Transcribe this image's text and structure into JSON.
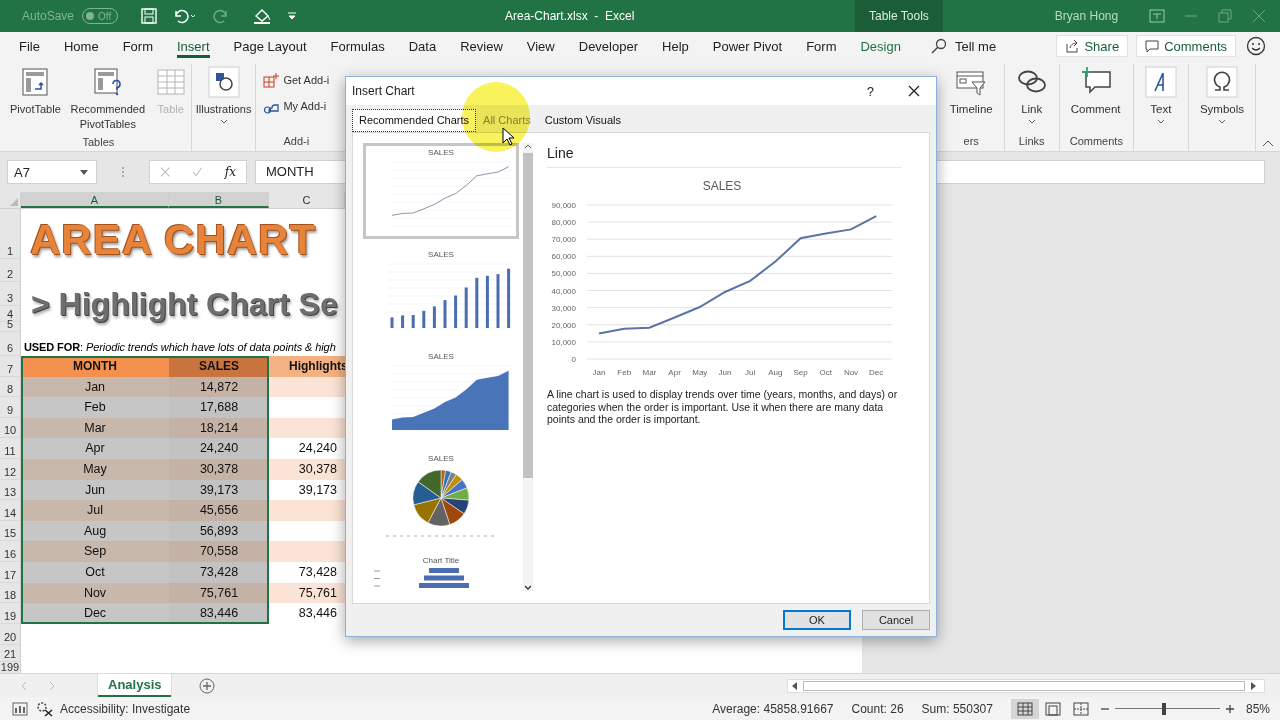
{
  "title_bar": {
    "autosave_label": "AutoSave",
    "autosave_toggle": {
      "label": "Off",
      "on": false
    },
    "document_title": "Area-Chart.xlsx  -  Excel",
    "context_tab": "Table Tools",
    "user_name": "Bryan Hong"
  },
  "ribbon_tabs": [
    {
      "label": "File",
      "selected": false,
      "kind": "plain"
    },
    {
      "label": "Home",
      "selected": false,
      "kind": "plain"
    },
    {
      "label": "Form",
      "selected": false,
      "kind": "plain"
    },
    {
      "label": "Insert",
      "selected": true,
      "kind": "plain"
    },
    {
      "label": "Page Layout",
      "selected": false,
      "kind": "plain"
    },
    {
      "label": "Formulas",
      "selected": false,
      "kind": "plain"
    },
    {
      "label": "Data",
      "selected": false,
      "kind": "plain"
    },
    {
      "label": "Review",
      "selected": false,
      "kind": "plain"
    },
    {
      "label": "View",
      "selected": false,
      "kind": "plain"
    },
    {
      "label": "Developer",
      "selected": false,
      "kind": "plain"
    },
    {
      "label": "Help",
      "selected": false,
      "kind": "plain"
    },
    {
      "label": "Power Pivot",
      "selected": false,
      "kind": "plain"
    },
    {
      "label": "Form",
      "selected": false,
      "kind": "plain"
    },
    {
      "label": "Design",
      "selected": false,
      "kind": "contextual"
    }
  ],
  "tell_me": "Tell me",
  "share_button": "Share",
  "comments_button": "Comments",
  "ribbon_left": [
    {
      "label": "Tables",
      "commands": [
        {
          "label": "PivotTable",
          "kind": "pivot",
          "disabled": false,
          "dropdown": false
        },
        {
          "label": "Recommended PivotTables",
          "kind": "recpivot",
          "disabled": false,
          "dropdown": false
        },
        {
          "label": "Table",
          "kind": "table",
          "disabled": true,
          "dropdown": false
        }
      ]
    },
    {
      "commands": [
        {
          "label": "Illustrations",
          "kind": "illus",
          "disabled": false,
          "dropdown": true
        }
      ]
    },
    {
      "label": "Add-i",
      "commands": [
        {
          "label": "Get Add-i",
          "kind": "getadd",
          "disabled": false,
          "dropdown": false
        },
        {
          "label": "My Add-i",
          "kind": "myadd",
          "disabled": false,
          "dropdown": false
        }
      ]
    }
  ],
  "ribbon_right": [
    {
      "label": "ers",
      "commands": [
        {
          "label": "Timeline",
          "kind": "timeline",
          "disabled": false,
          "dropdown": false
        }
      ]
    },
    {
      "label": "Links",
      "commands": [
        {
          "label": "Link",
          "kind": "link",
          "disabled": false,
          "dropdown": true
        }
      ]
    },
    {
      "label": "Comments",
      "commands": [
        {
          "label": "Comment",
          "kind": "comment",
          "disabled": false,
          "dropdown": false
        }
      ]
    },
    {
      "commands": [
        {
          "label": "Text",
          "kind": "text",
          "disabled": false,
          "dropdown": true
        }
      ]
    },
    {
      "commands": [
        {
          "label": "Symbols",
          "kind": "symbols",
          "disabled": false,
          "dropdown": true
        }
      ]
    }
  ],
  "formula_bar": {
    "name_box": "A7",
    "insert_function": "fx",
    "formula": "MONTH"
  },
  "sheet": {
    "column_headers": [
      "A",
      "B",
      "C"
    ],
    "top_row_numbers": [
      "1",
      "2",
      "3",
      "4",
      "5",
      "6"
    ],
    "title": "AREA CHART",
    "subtitle": "> Highlight Chart Se",
    "note": "**USED FOR**: *Periodic trends which have lots of data points & high*",
    "table": {
      "selected": true,
      "header_row_number": "7",
      "columns": [
        "MONTH",
        "SALES",
        "Highlights"
      ],
      "rows": [
        {
          "number": "8",
          "month": "Jan",
          "sales": "14,872"
        },
        {
          "number": "9",
          "month": "Feb",
          "sales": "17,688"
        },
        {
          "number": "10",
          "month": "Mar",
          "sales": "18,214"
        },
        {
          "number": "11",
          "month": "Apr",
          "sales": "24,240",
          "highlight": "24,240"
        },
        {
          "number": "12",
          "month": "May",
          "sales": "30,378",
          "highlight": "30,378"
        },
        {
          "number": "13",
          "month": "Jun",
          "sales": "39,173",
          "highlight": "39,173"
        },
        {
          "number": "14",
          "month": "Jul",
          "sales": "45,656"
        },
        {
          "number": "15",
          "month": "Aug",
          "sales": "56,893"
        },
        {
          "number": "16",
          "month": "Sep",
          "sales": "70,558"
        },
        {
          "number": "17",
          "month": "Oct",
          "sales": "73,428",
          "highlight": "73,428"
        },
        {
          "number": "18",
          "month": "Nov",
          "sales": "75,761",
          "highlight": "75,761"
        },
        {
          "number": "19",
          "month": "Dec",
          "sales": "83,446",
          "highlight": "83,446"
        }
      ]
    },
    "bottom_row_numbers": [
      "20",
      "21",
      "199"
    ]
  },
  "sheet_tabs": [
    {
      "label": "Analysis",
      "selected": true
    }
  ],
  "status_bar": {
    "accessibility": "Accessibility: Investigate",
    "average": "Average: 45858.91667",
    "count": "Count: 26",
    "sum": "Sum: 550307",
    "views": [
      {
        "kind": "normal",
        "selected": true
      },
      {
        "kind": "page-layout",
        "selected": false
      },
      {
        "kind": "page-break",
        "selected": false
      }
    ],
    "zoom": {
      "level": 0.47,
      "reading": "85%"
    }
  },
  "dialog": {
    "title": "Insert Chart",
    "help": "?",
    "tabs": [
      {
        "label": "Recommended Charts",
        "selected": true
      },
      {
        "label": "All Charts",
        "selected": false
      },
      {
        "label": "Custom Visuals",
        "selected": false
      }
    ],
    "thumbnails": [
      {
        "kind": "line",
        "title": "SALES",
        "selected": true
      },
      {
        "kind": "column",
        "title": "SALES",
        "selected": false
      },
      {
        "kind": "area",
        "title": "SALES",
        "selected": false
      },
      {
        "kind": "pie",
        "title": "SALES",
        "selected": false
      },
      {
        "kind": "funnel",
        "title": "Chart Title",
        "selected": false
      }
    ],
    "preview": {
      "heading": "Line",
      "chart_data": {
        "type": "line",
        "title": "SALES",
        "categories": [
          "Jan",
          "Feb",
          "Mar",
          "Apr",
          "May",
          "Jun",
          "Jul",
          "Aug",
          "Sep",
          "Oct",
          "Nov",
          "Dec"
        ],
        "grid": true,
        "series": [
          {
            "color": "#5b74a6",
            "values": [
              14872,
              17688,
              18214,
              24240,
              30378,
              39173,
              45656,
              56893,
              70558,
              73428,
              75761,
              83446
            ]
          }
        ],
        "ylim": [
          0,
          90000
        ],
        "yticks": [
          {
            "value": 0,
            "label": "0"
          },
          {
            "value": 10000,
            "label": "10,000"
          },
          {
            "value": 20000,
            "label": "20,000"
          },
          {
            "value": 30000,
            "label": "30,000"
          },
          {
            "value": 40000,
            "label": "40,000"
          },
          {
            "value": 50000,
            "label": "50,000"
          },
          {
            "value": 60000,
            "label": "60,000"
          },
          {
            "value": 70000,
            "label": "70,000"
          },
          {
            "value": 80000,
            "label": "80,000"
          },
          {
            "value": 90000,
            "label": "90,000"
          }
        ]
      },
      "description": "A line chart is used to display trends over time (years, months, and days) or categories when the order is important. Use it when there are many data points and the order is important."
    },
    "buttons": [
      {
        "label": "OK",
        "default": true
      },
      {
        "label": "Cancel",
        "default": false
      }
    ]
  }
}
